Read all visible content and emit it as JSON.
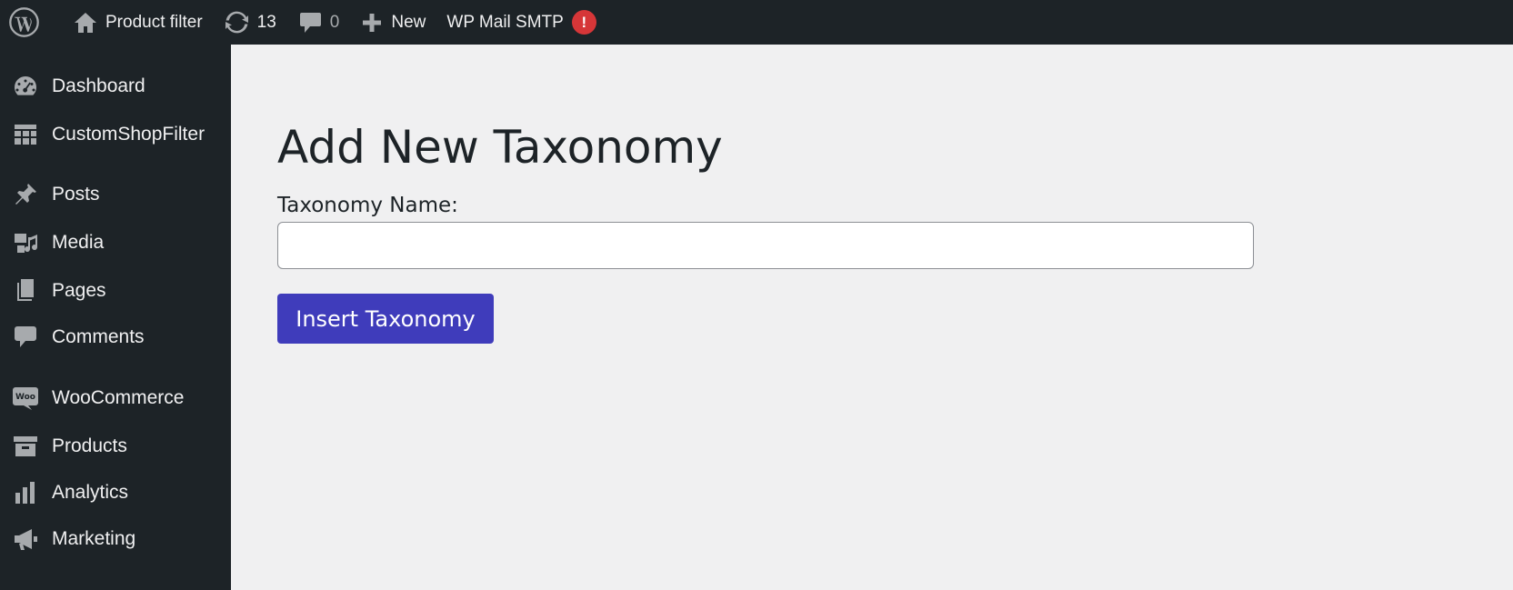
{
  "adminbar": {
    "site_name": "Product filter",
    "updates_count": "13",
    "comments_count": "0",
    "new_label": "New",
    "smtp_label": "WP Mail SMTP",
    "smtp_badge": "!"
  },
  "sidebar": {
    "items": [
      {
        "label": "Dashboard",
        "icon": "dashboard-icon"
      },
      {
        "label": "CustomShopFilter",
        "icon": "table-icon"
      },
      {
        "label": "Posts",
        "icon": "pin-icon"
      },
      {
        "label": "Media",
        "icon": "media-icon"
      },
      {
        "label": "Pages",
        "icon": "pages-icon"
      },
      {
        "label": "Comments",
        "icon": "comment-icon"
      },
      {
        "label": "WooCommerce",
        "icon": "woo-icon"
      },
      {
        "label": "Products",
        "icon": "archive-icon"
      },
      {
        "label": "Analytics",
        "icon": "chart-bar-icon"
      },
      {
        "label": "Marketing",
        "icon": "megaphone-icon"
      }
    ]
  },
  "main": {
    "title": "Add New Taxonomy",
    "field_label": "Taxonomy Name:",
    "input_value": "",
    "button_label": "Insert Taxonomy"
  },
  "colors": {
    "admin_dark": "#1d2327",
    "content_bg": "#f0f0f1",
    "button_accent": "#3f3cbb",
    "badge_red": "#d63638"
  }
}
